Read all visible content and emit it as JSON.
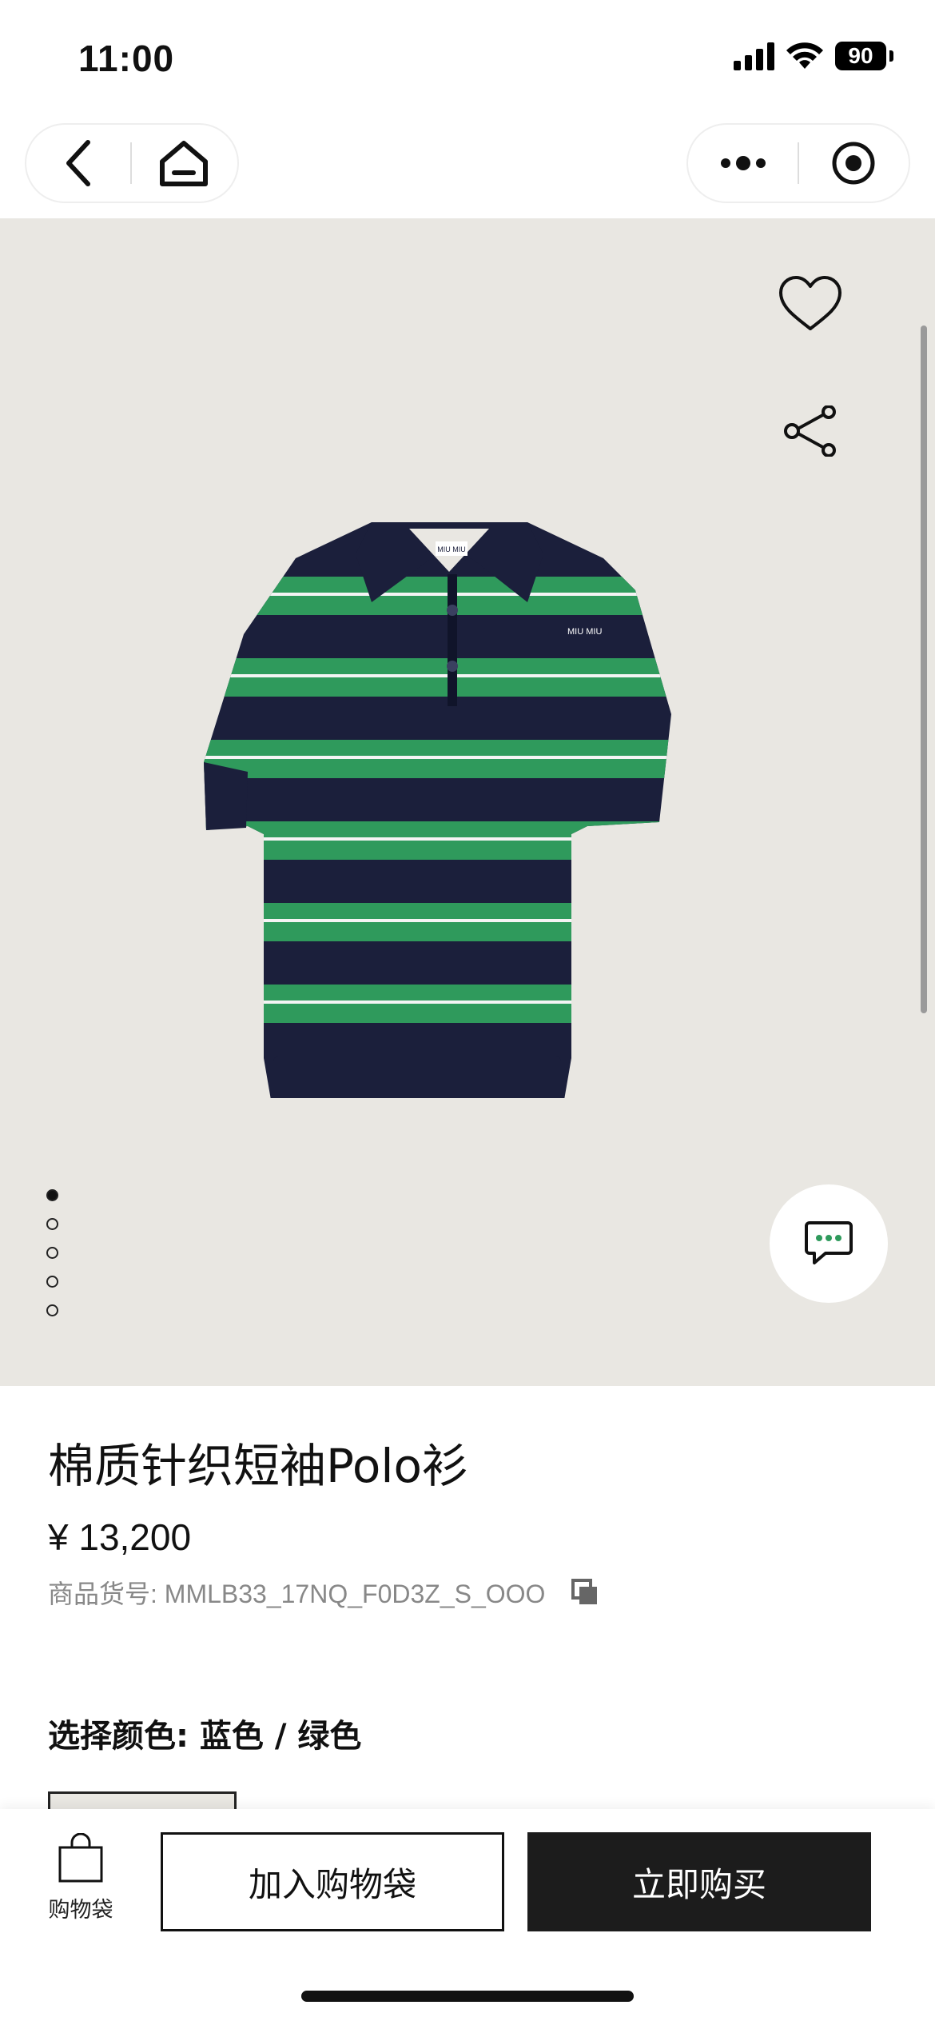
{
  "status_bar": {
    "time": "11:00",
    "battery": "90"
  },
  "nav": {
    "back_icon": "chevron-left-icon",
    "home_icon": "home-icon",
    "more_icon": "more-dots-icon",
    "close_icon": "target-icon"
  },
  "gallery": {
    "image_count": 5,
    "active_index": 0,
    "favorite_icon": "heart-icon",
    "share_icon": "share-icon",
    "chat_icon": "chat-bubble-icon",
    "colors": {
      "navy": "#1b1f3b",
      "green": "#2f9a5c",
      "background": "#e9e7e2"
    }
  },
  "product": {
    "title": "棉质针织短袖Polo衫",
    "price": "¥ 13,200",
    "sku": "商品货号: MMLB33_17NQ_F0D3Z_S_OOO",
    "color_label": "选择颜色: 蓝色 / 绿色"
  },
  "bottom_bar": {
    "bag_label": "购物袋",
    "add_to_bag": "加入购物袋",
    "buy_now": "立即购买"
  }
}
